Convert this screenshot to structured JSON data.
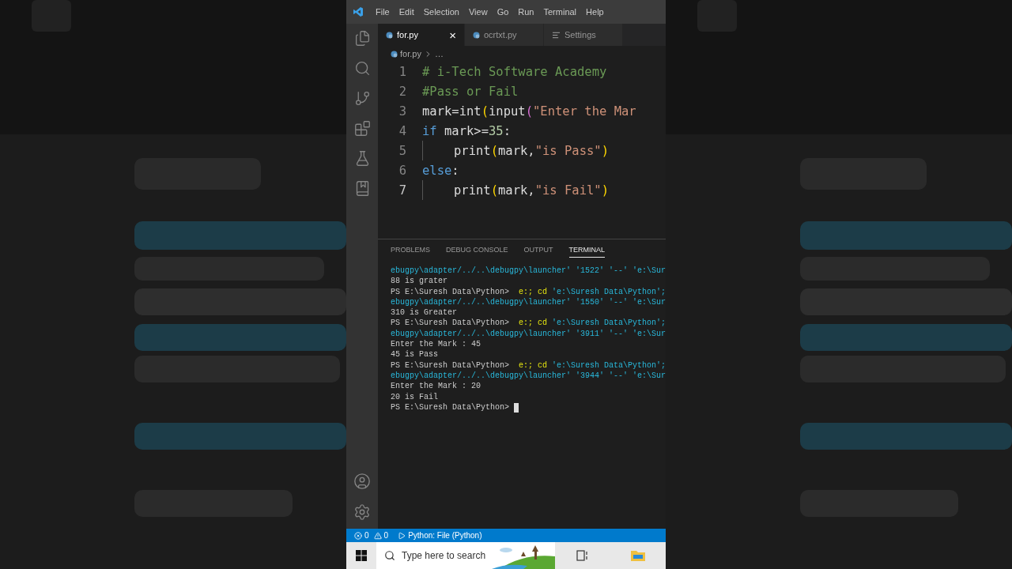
{
  "menu": [
    "File",
    "Edit",
    "Selection",
    "View",
    "Go",
    "Run",
    "Terminal",
    "Help"
  ],
  "tabs": [
    {
      "label": "for.py",
      "kind": "python",
      "selected": true
    },
    {
      "label": "ocrtxt.py",
      "kind": "python",
      "selected": false
    },
    {
      "label": "Settings",
      "kind": "settings",
      "selected": false
    }
  ],
  "close_glyph": "×",
  "breadcrumb": [
    "for.py",
    "…"
  ],
  "code_lines": [
    {
      "number": "1",
      "current": false,
      "tokens": [
        {
          "kind": "comment",
          "text": "# i-Tech Software Academy"
        }
      ]
    },
    {
      "number": "2",
      "current": false,
      "tokens": [
        {
          "kind": "comment",
          "text": "#Pass or Fail"
        }
      ]
    },
    {
      "number": "3",
      "current": false,
      "tokens": [
        {
          "kind": "plain",
          "text": "mark=int"
        },
        {
          "kind": "paren",
          "text": "("
        },
        {
          "kind": "plain",
          "text": "input"
        },
        {
          "kind": "paren2",
          "text": "("
        },
        {
          "kind": "string",
          "text": "\"Enter the Mar"
        }
      ]
    },
    {
      "number": "4",
      "current": false,
      "tokens": [
        {
          "kind": "keyword",
          "text": "if"
        },
        {
          "kind": "plain",
          "text": " mark>="
        },
        {
          "kind": "number",
          "text": "35"
        },
        {
          "kind": "plain",
          "text": ":"
        }
      ]
    },
    {
      "number": "5",
      "current": false,
      "tokens": [
        {
          "kind": "indent"
        },
        {
          "kind": "plain",
          "text": "print"
        },
        {
          "kind": "paren",
          "text": "("
        },
        {
          "kind": "plain",
          "text": "mark,"
        },
        {
          "kind": "string",
          "text": "\"is Pass\""
        },
        {
          "kind": "paren",
          "text": ")"
        }
      ]
    },
    {
      "number": "6",
      "current": false,
      "tokens": [
        {
          "kind": "keyword",
          "text": "else"
        },
        {
          "kind": "plain",
          "text": ":"
        }
      ]
    },
    {
      "number": "7",
      "current": true,
      "tokens": [
        {
          "kind": "indent"
        },
        {
          "kind": "plain",
          "text": "print"
        },
        {
          "kind": "paren",
          "text": "("
        },
        {
          "kind": "plain",
          "text": "mark,"
        },
        {
          "kind": "string",
          "text": "\"is Fail\""
        },
        {
          "kind": "paren",
          "text": ")"
        }
      ]
    }
  ],
  "panel_tabs": [
    {
      "label": "PROBLEMS",
      "selected": false
    },
    {
      "label": "DEBUG CONSOLE",
      "selected": false
    },
    {
      "label": "OUTPUT",
      "selected": false
    },
    {
      "label": "TERMINAL",
      "selected": true
    }
  ],
  "terminal_lines": [
    [
      {
        "kind": "path",
        "text": "ebugpy\\adapter/../..\\debugpy\\launcher' '1522' '--' 'e:\\Sur"
      }
    ],
    [
      {
        "kind": "plain",
        "text": "88 is grater"
      }
    ],
    [
      {
        "kind": "plain",
        "text": "PS E:\\Suresh Data\\Python>  "
      },
      {
        "kind": "command",
        "text": "e:; cd"
      },
      {
        "kind": "path",
        "text": " 'e:\\Suresh Data\\Python';"
      }
    ],
    [
      {
        "kind": "path",
        "text": "ebugpy\\adapter/../..\\debugpy\\launcher' '1550' '--' 'e:\\Sur"
      }
    ],
    [
      {
        "kind": "plain",
        "text": "310 is Greater"
      }
    ],
    [
      {
        "kind": "plain",
        "text": "PS E:\\Suresh Data\\Python>  "
      },
      {
        "kind": "command",
        "text": "e:; cd"
      },
      {
        "kind": "path",
        "text": " 'e:\\Suresh Data\\Python';"
      }
    ],
    [
      {
        "kind": "path",
        "text": "ebugpy\\adapter/../..\\debugpy\\launcher' '3911' '--' 'e:\\Sur"
      }
    ],
    [
      {
        "kind": "plain",
        "text": "Enter the Mark : 45"
      }
    ],
    [
      {
        "kind": "plain",
        "text": "45 is Pass"
      }
    ],
    [
      {
        "kind": "plain",
        "text": "PS E:\\Suresh Data\\Python>  "
      },
      {
        "kind": "command",
        "text": "e:; cd"
      },
      {
        "kind": "path",
        "text": " 'e:\\Suresh Data\\Python';"
      }
    ],
    [
      {
        "kind": "path",
        "text": "ebugpy\\adapter/../..\\debugpy\\launcher' '3944' '--' 'e:\\Sur"
      }
    ],
    [
      {
        "kind": "plain",
        "text": "Enter the Mark : 20"
      }
    ],
    [
      {
        "kind": "plain",
        "text": "20 is Fail"
      }
    ],
    [
      {
        "kind": "plain",
        "text": "PS E:\\Suresh Data\\Python>"
      },
      {
        "kind": "cursor"
      }
    ]
  ],
  "status": {
    "errors": "0",
    "warnings": "0",
    "run_config": "Python: File (Python)"
  },
  "taskbar": {
    "search_placeholder": "Type here to search"
  }
}
